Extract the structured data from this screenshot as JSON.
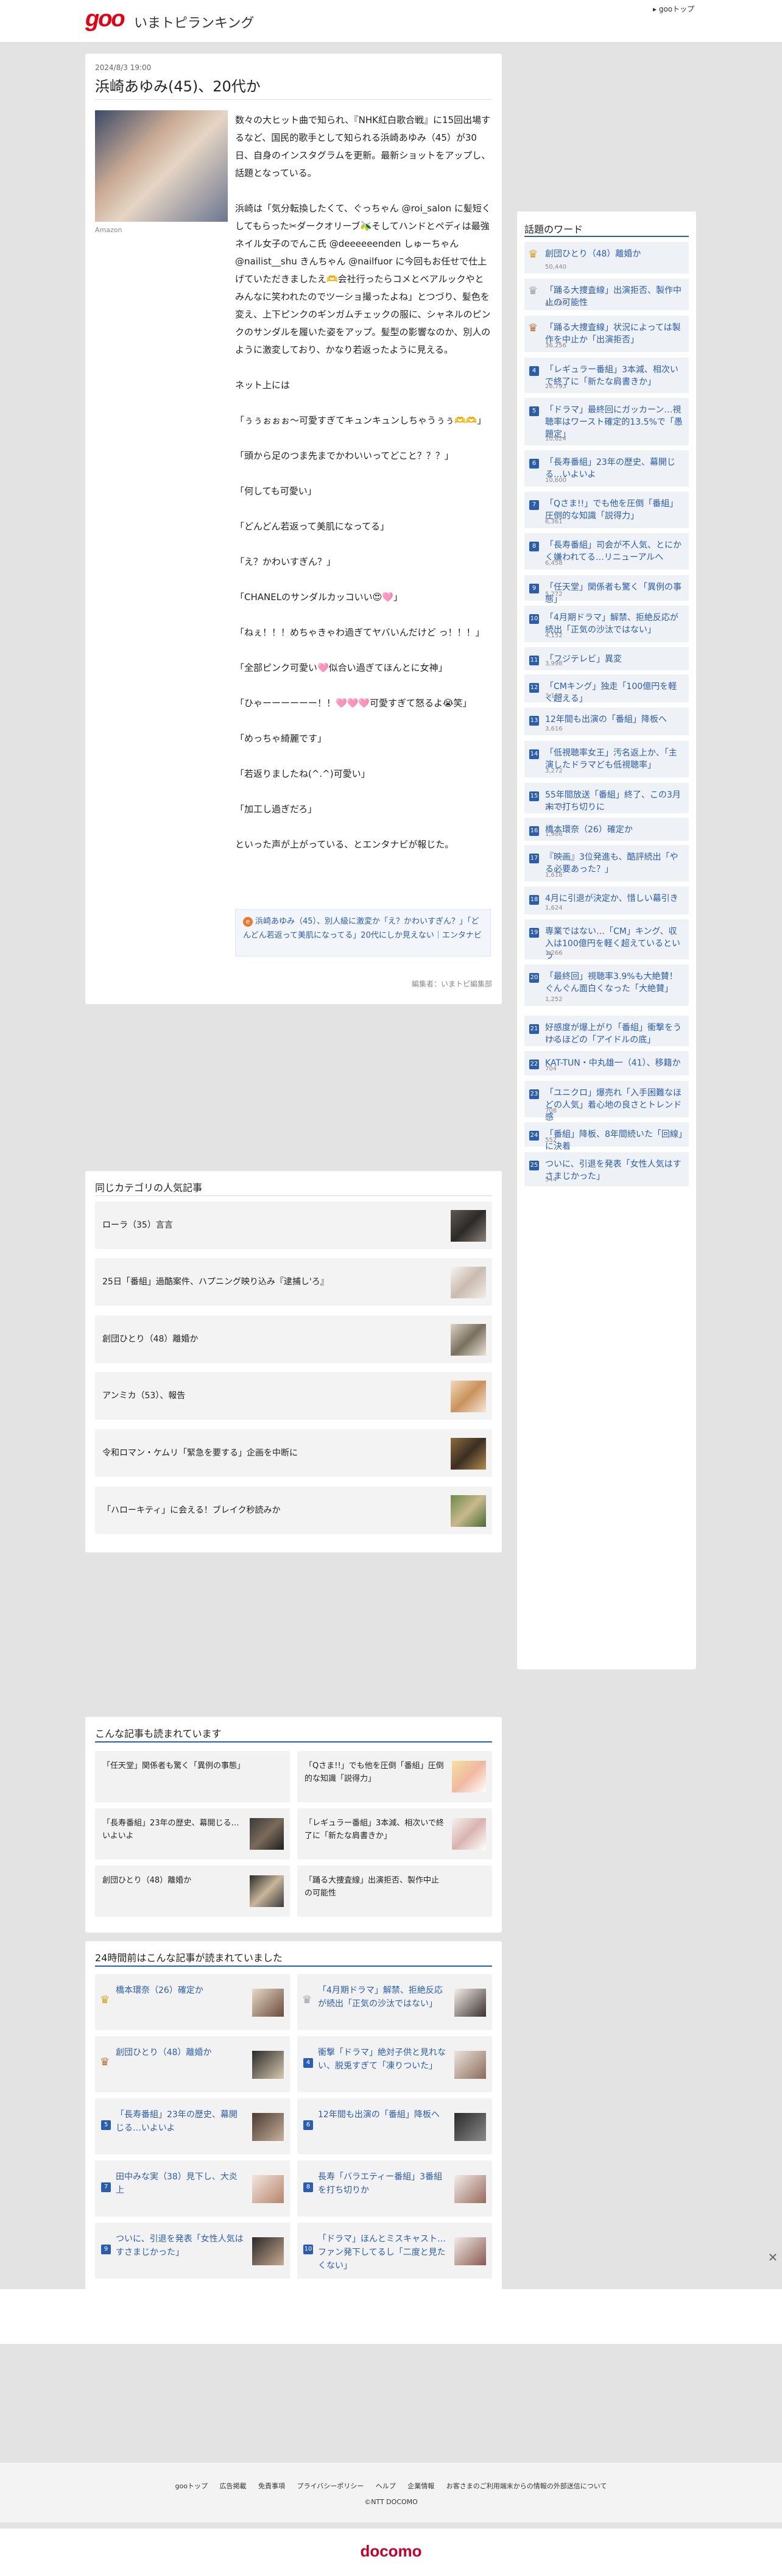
{
  "header": {
    "logo": "goo",
    "site_title": "いまトピランキング",
    "goo_top": "▸ gooトップ"
  },
  "article": {
    "date": "2024/8/3 19:00",
    "title": "浜崎あゆみ(45)、20代か",
    "photo_credit": "Amazon",
    "paragraphs": [
      "数々の大ヒット曲で知られ、『NHK紅白歌合戦』に15回出場するなど、国民的歌手として知られる浜崎あゆみ（45）が30日、自身のインスタグラムを更新。最新ショットをアップし、話題となっている。",
      "浜崎は「気分転換したくて、ぐっちゃん @roi_salon に髪短くしてもらった✂︎ダークオリーブ🫒そしてハンドとペディは最強ネイル女子のでんこ氏 @deeeeeenden しゅーちゃん @nailist__shu きんちゃん @nailfuor に今回もお任せで仕上げていただきましたえ🫶会社行ったらコメとベアルックやとみんなに笑われたのでツーショ撮ったよね」とつづり、髪色を変え、上下ピンクのギンガムチェックの服に、シャネルのピンクのサンダルを履いた姿をアップ。髪型の影響なのか、別人のように激変しており、かなり若返ったように見える。",
      "ネット上には",
      "「ぅぅぉぉぉ〜可愛すぎてキュンキュンしちゃうぅぅ🫶🫶」",
      "「頭から足のつま先までかわいいってどこと？？？」",
      "「何しても可愛い」",
      "「どんどん若返って美肌になってる」",
      "「え？かわいすぎん？」",
      "「CHANELのサンダルカッコいい😍🩷」",
      "「ねぇ！！！めちゃきゃわ過ぎてヤバいんだけど っ！！！」",
      "「全部ピンク可愛い🩷似合い過ぎてほんとに女神」",
      "「ひゃーーーーーー！！🩷🩷🩷可愛すぎて怒るよ😭笑」",
      "「めっちゃ綺麗です」",
      "「若返りましたね(^.^)可愛い」",
      "「加工し過ぎだろ」",
      "といった声が上がっている、とエンタナビが報じた。"
    ],
    "related_links": [
      "浜崎あゆみ（45）、別人級に激変か「え？かわいすぎん？」「どんどん若返って美肌になってる」20代にしか見えない｜エンタナビ"
    ],
    "editor": "編集者：いまトピ編集部"
  },
  "category": {
    "title": "同じカテゴリの人気記事",
    "items": [
      "ローラ（35）言言",
      "25日「番組」過酷案件、ハプニング映り込み『逮捕し'ろ』",
      "創団ひとり（48）離婚か",
      "アンミカ（53）、報告",
      "令和ロマン・ケムリ「緊急を要する」企画を中断に",
      "「ハローキティ」に会える！ブレイク秒読みか"
    ]
  },
  "sidebar": {
    "title": "話題のワード",
    "words": [
      {
        "rank": "1",
        "text": "創団ひとり（48）離婚か",
        "count": "50,440"
      },
      {
        "rank": "2",
        "text": "「踊る大捜査線」出演拒否、製作中止の可能性",
        "count": "45,289"
      },
      {
        "rank": "3",
        "text": "「踊る大捜査線」状況によっては製作を中止か「出演拒否」",
        "count": "36,256"
      },
      {
        "rank": "4",
        "text": "「レギュラー番組」3本減、相次いで終了に「新たな肩書きか」",
        "count": "26,793"
      },
      {
        "rank": "5",
        "text": "「ドラマ」最終回にガッカーン…視聴率はワースト確定的13.5%で「愚題定」",
        "count": "10,624"
      },
      {
        "rank": "6",
        "text": "「長寿番組」23年の歴史、幕開じる…いよいよ",
        "count": "10,600"
      },
      {
        "rank": "7",
        "text": "「Qさま!!」でも他を圧倒「番組」圧倒的な知識「説得力」",
        "count": "6,361"
      },
      {
        "rank": "8",
        "text": "「長寿番組」司会が不人気、とにかく嫌われてる…リニューアルへ",
        "count": "6,458"
      },
      {
        "rank": "9",
        "text": "「任天堂」関係者も驚く「異例の事態」",
        "count": "5,272"
      },
      {
        "rank": "10",
        "text": "「4月期ドラマ」解禁、拒絶反応が続出「正気の沙汰ではない」",
        "count": "4,152"
      },
      {
        "rank": "11",
        "text": "「フジテレビ」異変",
        "count": "3,998"
      },
      {
        "rank": "12",
        "text": "「CMキング」独走「100億円を軽く超える」",
        "count": "3,153"
      },
      {
        "rank": "13",
        "text": "12年間も出演の「番組」降板へ",
        "count": "3,616"
      },
      {
        "rank": "14",
        "text": "「低視聴率女王」汚名返上か、「主演したドラマども低視聴率」",
        "count": "3,272"
      },
      {
        "rank": "15",
        "text": "55年間放送「番組」終了、この3月末で打ち切りに",
        "count": "2,124"
      },
      {
        "rank": "16",
        "text": "橋本環奈（26）確定か",
        "count": "1,986"
      },
      {
        "rank": "17",
        "text": "『映画』3位発進も、酷評続出「やる必要あった？」",
        "count": "1,618"
      },
      {
        "rank": "18",
        "text": "4月に引退が決定か、惜しい幕引き",
        "count": "1,624"
      },
      {
        "rank": "19",
        "text": "専業ではない…「CM」キング、収入は100億円を軽く超えているという",
        "count": "1,266"
      },
      {
        "rank": "20",
        "text": "「最終回」視聴率3.9%も大絶賛！ぐんぐん面白くなった「大絶賛」",
        "count": "1,252"
      },
      {
        "rank": "21",
        "text": "好感度が爆上がり「番組」衝撃をうけるほどの「アイドルの底」",
        "count": "720"
      },
      {
        "rank": "22",
        "text": "KAT-TUN・中丸雄一（41）、移籍か",
        "count": "704"
      },
      {
        "rank": "23",
        "text": "「ユニクロ」爆売れ「入手困難なほどの人気」着心地の良さとトレンド感",
        "count": "708"
      },
      {
        "rank": "24",
        "text": "「番組」降板、8年間続いた「回線」に決着",
        "count": "552"
      },
      {
        "rank": "25",
        "text": "ついに、引退を発表「女性人気はすさまじかった」",
        "count": "544"
      }
    ]
  },
  "reading": {
    "title": "こんな記事も読まれています",
    "items": [
      "「任天堂」関係者も驚く「異例の事態」",
      "「Qさま!!」でも他を圧倒「番組」圧倒的な知識「説得力」",
      "「長寿番組」23年の歴史、幕開じる…いよいよ",
      "「レギュラー番組」3本減、相次いで終了に「新たな肩書きか」",
      "創団ひとり（48）離婚か",
      "「踊る大捜査線」出演拒否、製作中止の可能性"
    ]
  },
  "h24": {
    "title": "24時間前はこんな記事が読まれていました",
    "items": [
      {
        "rank": "1",
        "text": "橋本環奈（26）確定か"
      },
      {
        "rank": "2",
        "text": "「4月期ドラマ」解禁、拒絶反応が続出「正気の沙汰ではない」"
      },
      {
        "rank": "3",
        "text": "創団ひとり（48）離婚か"
      },
      {
        "rank": "4",
        "text": "衝撃「ドラマ」絶対子供と見れない、脱兎すぎて「凍りついた」"
      },
      {
        "rank": "5",
        "text": "「長寿番組」23年の歴史、幕開じる…いよいよ"
      },
      {
        "rank": "6",
        "text": "12年間も出演の「番組」降板へ"
      },
      {
        "rank": "7",
        "text": "田中みな実（38）見下し、大炎上"
      },
      {
        "rank": "8",
        "text": "長寿「バラエティー番組」3番組を打ち切りか"
      },
      {
        "rank": "9",
        "text": "ついに、引退を発表「女性人気はすさまじかった」"
      },
      {
        "rank": "10",
        "text": "「ドラマ」ほんとミスキャスト…ファン発下してるし「二度と見たくない」"
      }
    ]
  },
  "ad": {
    "close": "✕"
  },
  "footer": {
    "links": [
      "gooトップ",
      "広告掲載",
      "免責事項",
      "プライバシーポリシー",
      "ヘルプ",
      "企業情報",
      "お客さまのご利用端末からの情報の外部送信について"
    ],
    "copyright": "©NTT DOCOMO",
    "brand": "docomo"
  },
  "colors": {
    "accent": "#2a5db0",
    "brand_red": "#e60012",
    "docomo_red": "#c4002b",
    "crown_gold": "#d9a21b",
    "crown_silver": "#9aa0a8",
    "crown_bronze": "#b8713a"
  }
}
